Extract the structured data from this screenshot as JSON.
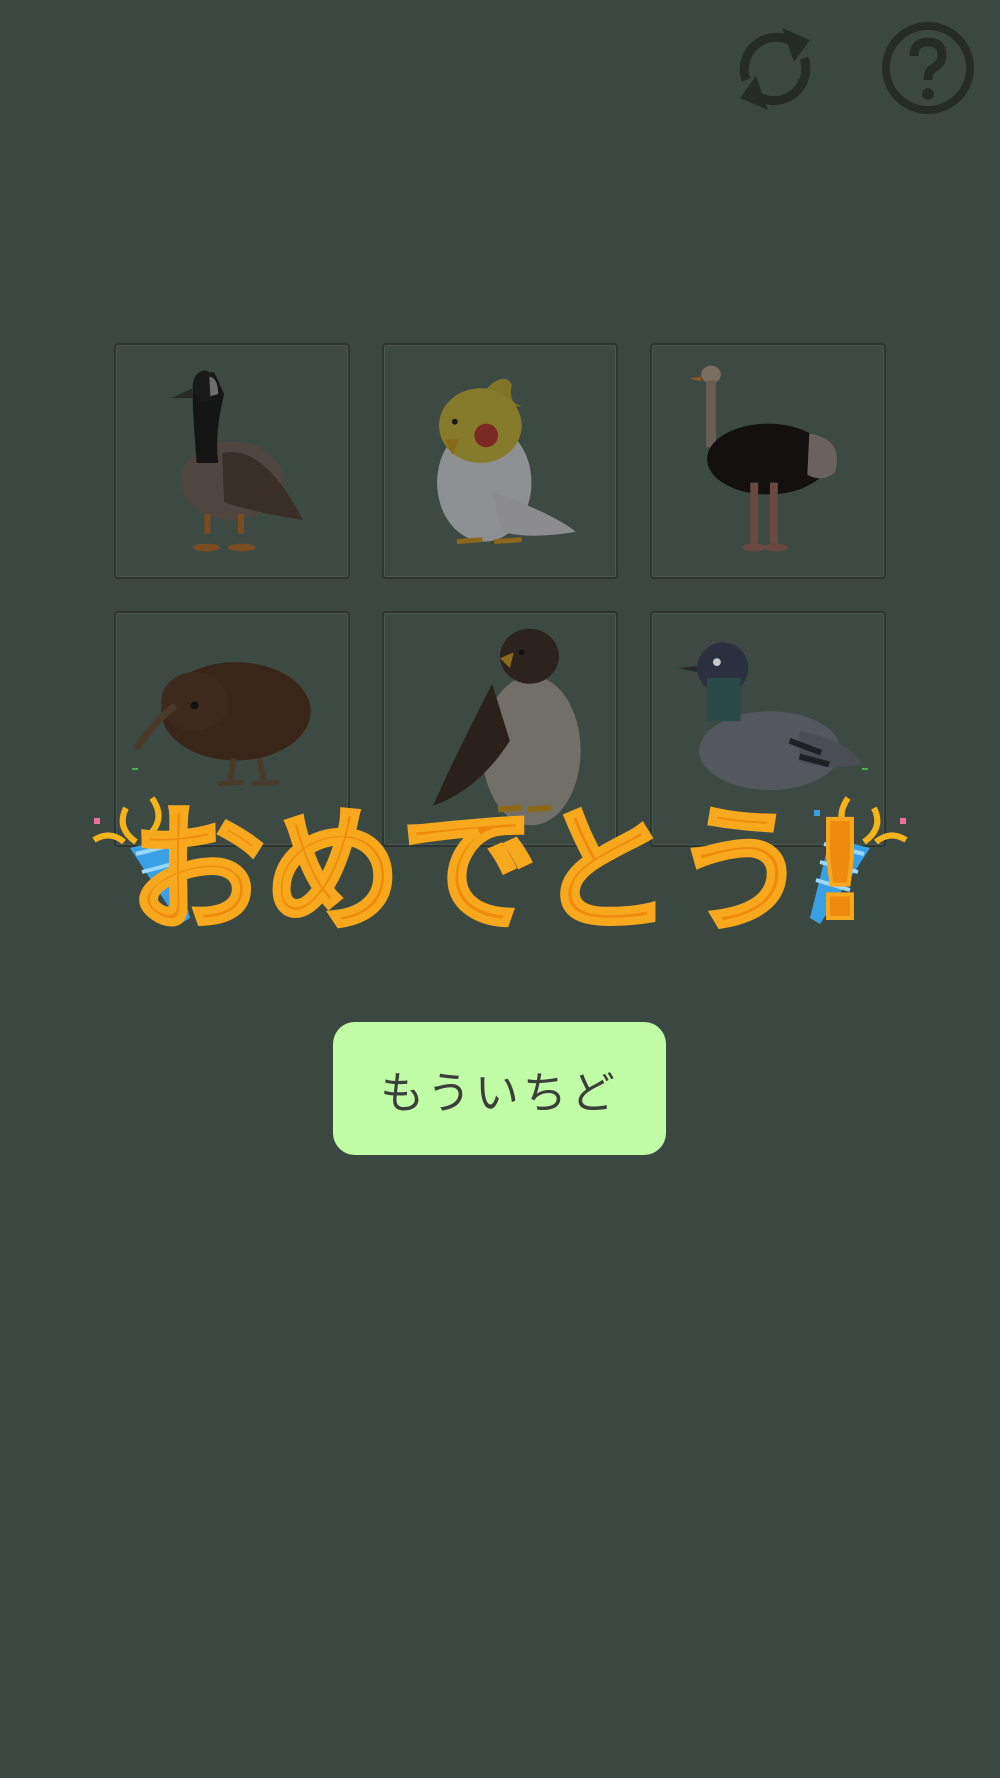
{
  "header": {
    "refresh_icon": "refresh-icon",
    "help_icon": "help-icon"
  },
  "cards": [
    {
      "animal": "canada-goose"
    },
    {
      "animal": "cockatiel"
    },
    {
      "animal": "ostrich"
    },
    {
      "animal": "kiwi"
    },
    {
      "animal": "hawk"
    },
    {
      "animal": "pigeon"
    }
  ],
  "result": {
    "message": "おめでとう!"
  },
  "retry_button": {
    "label": "もういちど"
  },
  "colors": {
    "background": "#3b4842",
    "button": "#c0fda6",
    "banner_text": "#f08a0c"
  }
}
